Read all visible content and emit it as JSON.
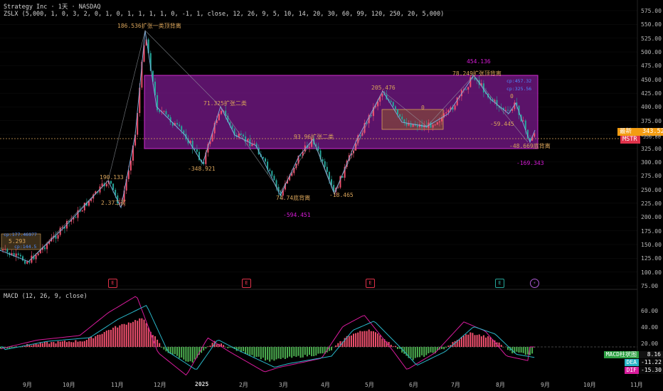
{
  "header": {
    "symbol_line": "Strategy Inc · 1天 · NASDAQ",
    "indicator_line": "ZSLX (5,000, 1, 0, 3, 2, 0, 1, 0, 1, 1, 1, 1, 0, -1, 1, close, 12, 26, 9, 5, 10, 14, 20, 30, 60, 99, 120, 250, 20, 5,000)",
    "macd_line": "MACD (12, 26, 9, close)"
  },
  "price_axis": [
    "575.00",
    "550.00",
    "525.00",
    "500.00",
    "475.00",
    "450.00",
    "425.00",
    "400.00",
    "375.00",
    "350.00",
    "325.00",
    "300.00",
    "275.00",
    "250.00",
    "225.00",
    "200.00",
    "175.00",
    "150.00",
    "125.00",
    "100.00",
    "75.00"
  ],
  "macd_axis": [
    "60.00",
    "40.00",
    "20.00",
    "0.00"
  ],
  "time_axis": [
    "9月",
    "10月",
    "11月",
    "12月",
    "2025",
    "2月",
    "3月",
    "4月",
    "5月",
    "6月",
    "7月",
    "8月",
    "9月",
    "10月",
    "11月"
  ],
  "price_tags": {
    "last_label": "最新",
    "last_value": "343.52",
    "symbol": "MSTR",
    "sub_value": "330.00"
  },
  "macd_tags": [
    {
      "label": "MACD柱状图",
      "value": "8.16",
      "color": "#2ea043"
    },
    {
      "label": "DEA",
      "value": "-11.22",
      "color": "#29b6c8"
    },
    {
      "label": "DIF",
      "value": "-15.30",
      "color": "#d81b9c"
    }
  ],
  "annotations": [
    {
      "text": "186.536扩张一类顶背离",
      "color": "#d9a45a"
    },
    {
      "text": "190.133",
      "color": "#d9a45a"
    },
    {
      "text": "2.37二买",
      "color": "#d9a45a"
    },
    {
      "text": "5.293",
      "color": "#d9a45a"
    },
    {
      "text": "cp:177.46977",
      "color": "#4e8cff"
    },
    {
      "text": "cp:144.5",
      "color": "#4e8cff"
    },
    {
      "text": "71.325扩张二类",
      "color": "#d9a45a"
    },
    {
      "text": "-348.921",
      "color": "#d9a45a"
    },
    {
      "text": "93.96扩张二类",
      "color": "#d9a45a"
    },
    {
      "text": "74.74底背离",
      "color": "#d9a45a"
    },
    {
      "text": "-594.451",
      "color": "#d81bd8"
    },
    {
      "text": "-18.465",
      "color": "#d9a45a"
    },
    {
      "text": "205.476",
      "color": "#d9a45a"
    },
    {
      "text": "454.136",
      "color": "#d81bd8"
    },
    {
      "text": "78.249扩张顶背离",
      "color": "#d9a45a"
    },
    {
      "text": "cp:457.32",
      "color": "#4e8cff"
    },
    {
      "text": "cp:325.56",
      "color": "#4e8cff"
    },
    {
      "text": "0",
      "color": "#d9a45a"
    },
    {
      "text": "0",
      "color": "#d9a45a"
    },
    {
      "text": "-59.445",
      "color": "#d9a45a"
    },
    {
      "text": "-48.669底背离",
      "color": "#d9a45a"
    },
    {
      "text": "-169.343",
      "color": "#d81bd8"
    }
  ],
  "events": [
    "E",
    "E",
    "E",
    "E",
    "⚡"
  ],
  "colors": {
    "up": "#f0506e",
    "down": "#26a69a",
    "zone": "#7a1a8c",
    "macd_up": "#f0506e",
    "macd_down": "#4caf50",
    "dif": "#d81b9c",
    "dea": "#29b6c8",
    "gold": "#d9a45a"
  }
}
